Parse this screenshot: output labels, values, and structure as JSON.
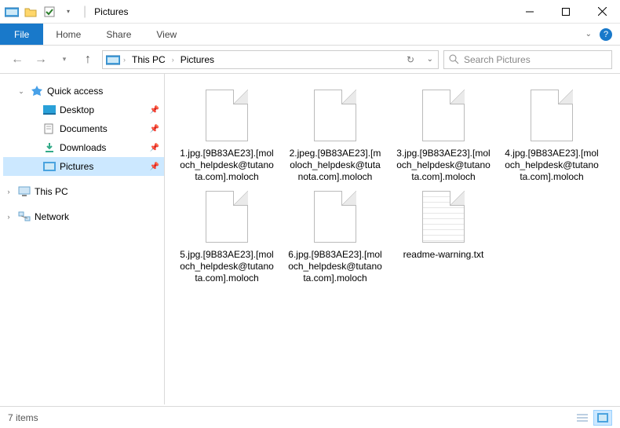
{
  "window": {
    "title_sep": "|",
    "title": "Pictures"
  },
  "ribbon": {
    "file": "File",
    "home": "Home",
    "share": "Share",
    "view": "View"
  },
  "address": {
    "segments": [
      "This PC",
      "Pictures"
    ],
    "search_placeholder": "Search Pictures"
  },
  "nav": {
    "quick_access": "Quick access",
    "desktop": "Desktop",
    "documents": "Documents",
    "downloads": "Downloads",
    "pictures": "Pictures",
    "this_pc": "This PC",
    "network": "Network"
  },
  "files": [
    {
      "name": "1.jpg.[9B83AE23].[moloch_helpdesk@tutanota.com].moloch",
      "type": "blank"
    },
    {
      "name": "2.jpeg.[9B83AE23].[moloch_helpdesk@tutanota.com].moloch",
      "type": "blank"
    },
    {
      "name": "3.jpg.[9B83AE23].[moloch_helpdesk@tutanota.com].moloch",
      "type": "blank"
    },
    {
      "name": "4.jpg.[9B83AE23].[moloch_helpdesk@tutanota.com].moloch",
      "type": "blank"
    },
    {
      "name": "5.jpg.[9B83AE23].[moloch_helpdesk@tutanota.com].moloch",
      "type": "blank"
    },
    {
      "name": "6.jpg.[9B83AE23].[moloch_helpdesk@tutanota.com].moloch",
      "type": "blank"
    },
    {
      "name": "readme-warning.txt",
      "type": "txt"
    }
  ],
  "status": {
    "count_label": "7 items"
  }
}
